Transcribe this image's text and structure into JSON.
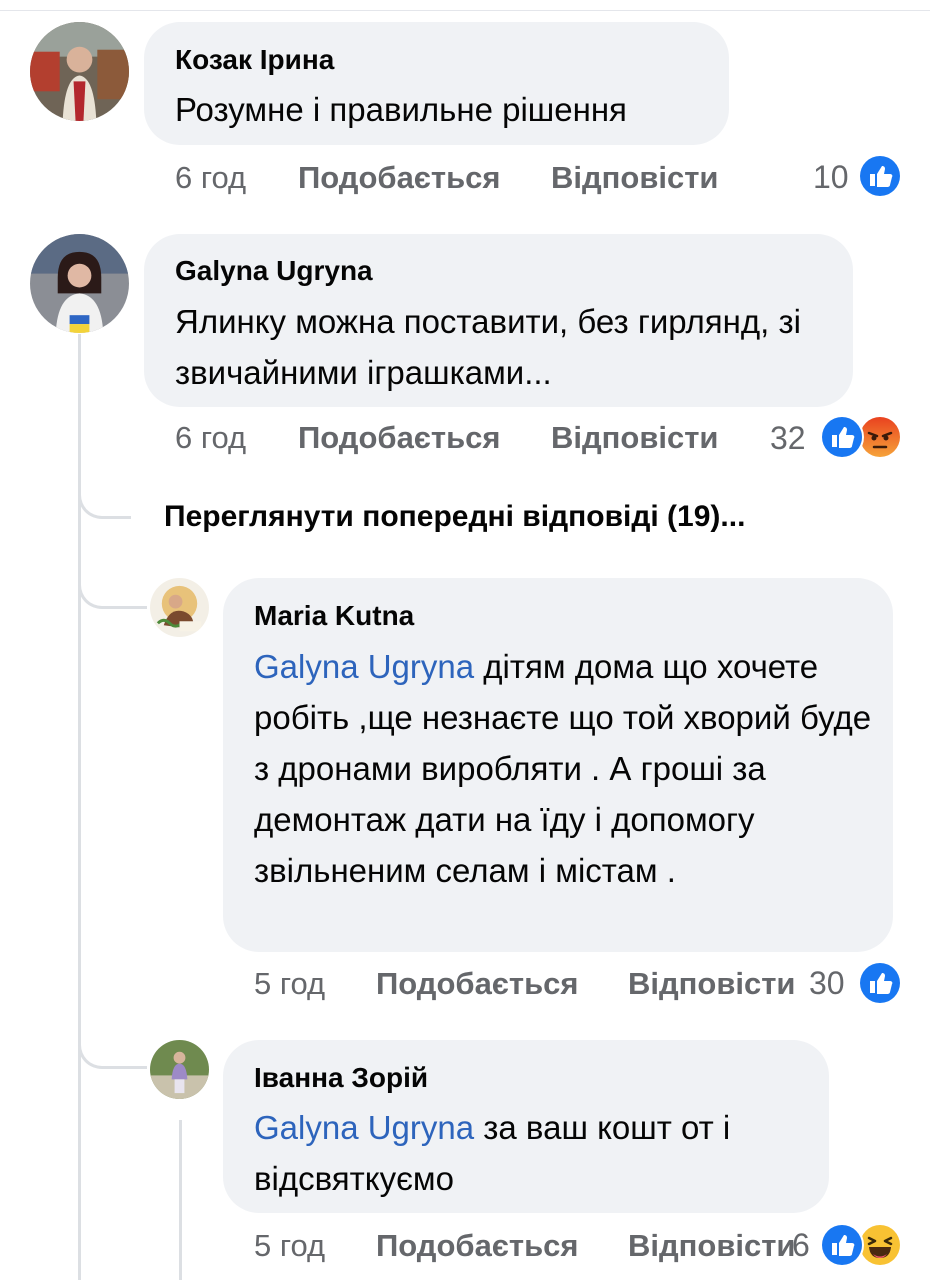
{
  "comments": [
    {
      "author": "Козак Ірина",
      "text": "Розумне і правильне рішення",
      "time": "6 год",
      "like_label": "Подобається",
      "reply_label": "Відповісти",
      "reaction_count": "10",
      "reactions": [
        "like-icon"
      ]
    },
    {
      "author": "Galyna Ugryna",
      "text": "Ялинку можна поставити, без гирлянд, зі звичайними іграшками...",
      "time": "6 год",
      "like_label": "Подобається",
      "reply_label": "Відповісти",
      "reaction_count": "32",
      "reactions": [
        "like-icon",
        "angry-icon"
      ]
    }
  ],
  "view_previous": "Переглянути попередні відповіді (19)...",
  "replies": [
    {
      "author": "Maria Kutna",
      "mention": "Galyna Ugryna",
      "text": " дітям дома що хочете робіть ,ще незнаєте що той хворий буде з дронами виробляти . А гроші за демонтаж дати на їду і допомогу звільненим селам і містам .",
      "time": "5 год",
      "like_label": "Подобається",
      "reply_label": "Відповісти",
      "reaction_count": "30",
      "reactions": [
        "like-icon"
      ]
    },
    {
      "author": "Іванна Зорій",
      "mention": "Galyna Ugryna",
      "text": " за ваш кошт от і відсвяткуємо",
      "time": "5 год",
      "like_label": "Подобається",
      "reply_label": "Відповісти",
      "reaction_count": "6",
      "reactions": [
        "like-icon",
        "haha-icon"
      ]
    }
  ],
  "colors": {
    "bubble": "#f0f2f5",
    "secondary_text": "#65676b",
    "mention": "#2d64bc",
    "like_blue": "#1877f2",
    "thread_line": "#dcdfe3"
  }
}
